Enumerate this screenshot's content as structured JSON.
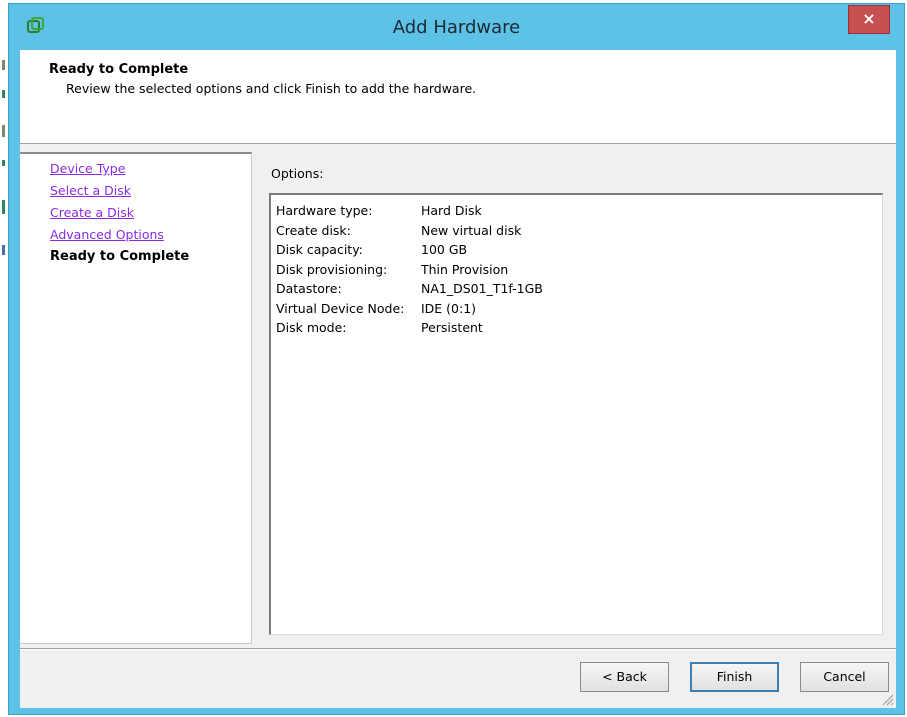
{
  "window": {
    "title": "Add Hardware",
    "close_glyph": "×"
  },
  "header": {
    "title": "Ready to Complete",
    "subtitle": "Review the selected options and click Finish to add the hardware."
  },
  "steps": [
    {
      "label": "Device Type",
      "state": "link"
    },
    {
      "label": "Select a Disk",
      "state": "link"
    },
    {
      "label": "Create a Disk",
      "state": "link"
    },
    {
      "label": "Advanced Options",
      "state": "link"
    },
    {
      "label": "Ready to Complete",
      "state": "current"
    }
  ],
  "options": {
    "label": "Options:",
    "rows": [
      {
        "key": "Hardware type:",
        "value": "Hard Disk"
      },
      {
        "key": "Create disk:",
        "value": "New virtual disk"
      },
      {
        "key": "Disk capacity:",
        "value": "100 GB"
      },
      {
        "key": "Disk provisioning:",
        "value": "Thin Provision"
      },
      {
        "key": "Datastore:",
        "value": "NA1_DS01_T1f-1GB"
      },
      {
        "key": "Virtual Device Node:",
        "value": "IDE (0:1)"
      },
      {
        "key": "Disk mode:",
        "value": "Persistent"
      }
    ]
  },
  "buttons": {
    "back": "< Back",
    "finish": "Finish",
    "cancel": "Cancel"
  },
  "colors": {
    "titlebar": "#5ec1e6",
    "close": "#c75050",
    "link": "#8a2be2"
  }
}
